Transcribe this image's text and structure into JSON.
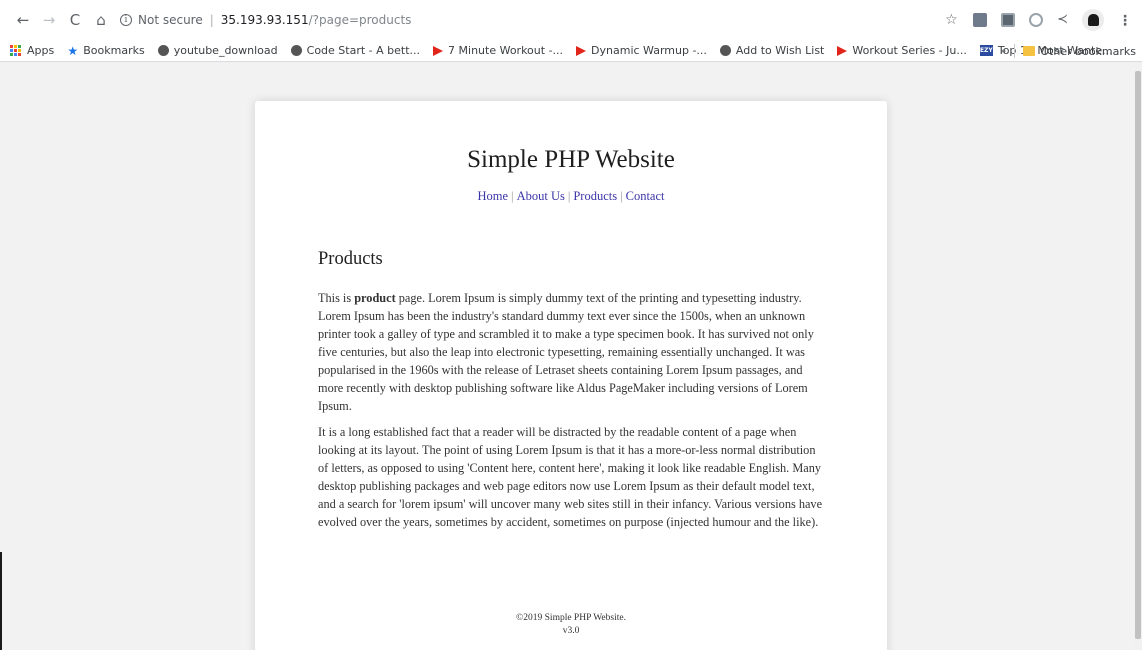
{
  "browser": {
    "security_label": "Not secure",
    "url_host": "35.193.93.151",
    "url_path": "/?page=products"
  },
  "bookmarks": {
    "items": [
      {
        "label": "Apps",
        "icon": "apps-grid-icon"
      },
      {
        "label": "Bookmarks",
        "icon": "star-icon"
      },
      {
        "label": "youtube_download",
        "icon": "globe-icon"
      },
      {
        "label": "Code Start - A bett...",
        "icon": "globe-icon"
      },
      {
        "label": "7 Minute Workout -...",
        "icon": "youtube-icon"
      },
      {
        "label": "Dynamic Warmup -...",
        "icon": "youtube-icon"
      },
      {
        "label": "Add to Wish List",
        "icon": "globe-icon"
      },
      {
        "label": "Workout Series - Ju...",
        "icon": "youtube-icon"
      },
      {
        "label": "Top 10 Most Wante...",
        "icon": "ezy-icon"
      }
    ],
    "overflow": "»",
    "other_label": "Other bookmarks"
  },
  "site": {
    "title": "Simple PHP Website",
    "nav": {
      "home": "Home",
      "about": "About Us",
      "products": "Products",
      "contact": "Contact"
    },
    "page_heading": "Products",
    "paragraph1_before": "This is ",
    "paragraph1_bold": "product",
    "paragraph1_after": " page. Lorem Ipsum is simply dummy text of the printing and typesetting industry. Lorem Ipsum has been the industry's standard dummy text ever since the 1500s, when an unknown printer took a galley of type and scrambled it to make a type specimen book. It has survived not only five centuries, but also the leap into electronic typesetting, remaining essentially unchanged. It was popularised in the 1960s with the release of Letraset sheets containing Lorem Ipsum passages, and more recently with desktop publishing software like Aldus PageMaker including versions of Lorem Ipsum.",
    "paragraph2": "It is a long established fact that a reader will be distracted by the readable content of a page when looking at its layout. The point of using Lorem Ipsum is that it has a more-or-less normal distribution of letters, as opposed to using 'Content here, content here', making it look like readable English. Many desktop publishing packages and web page editors now use Lorem Ipsum as their default model text, and a search for 'lorem ipsum' will uncover many web sites still in their infancy. Various versions have evolved over the years, sometimes by accident, sometimes on purpose (injected humour and the like).",
    "footer_copyright": "©2019 Simple PHP Website.",
    "footer_version": "v3.0"
  }
}
